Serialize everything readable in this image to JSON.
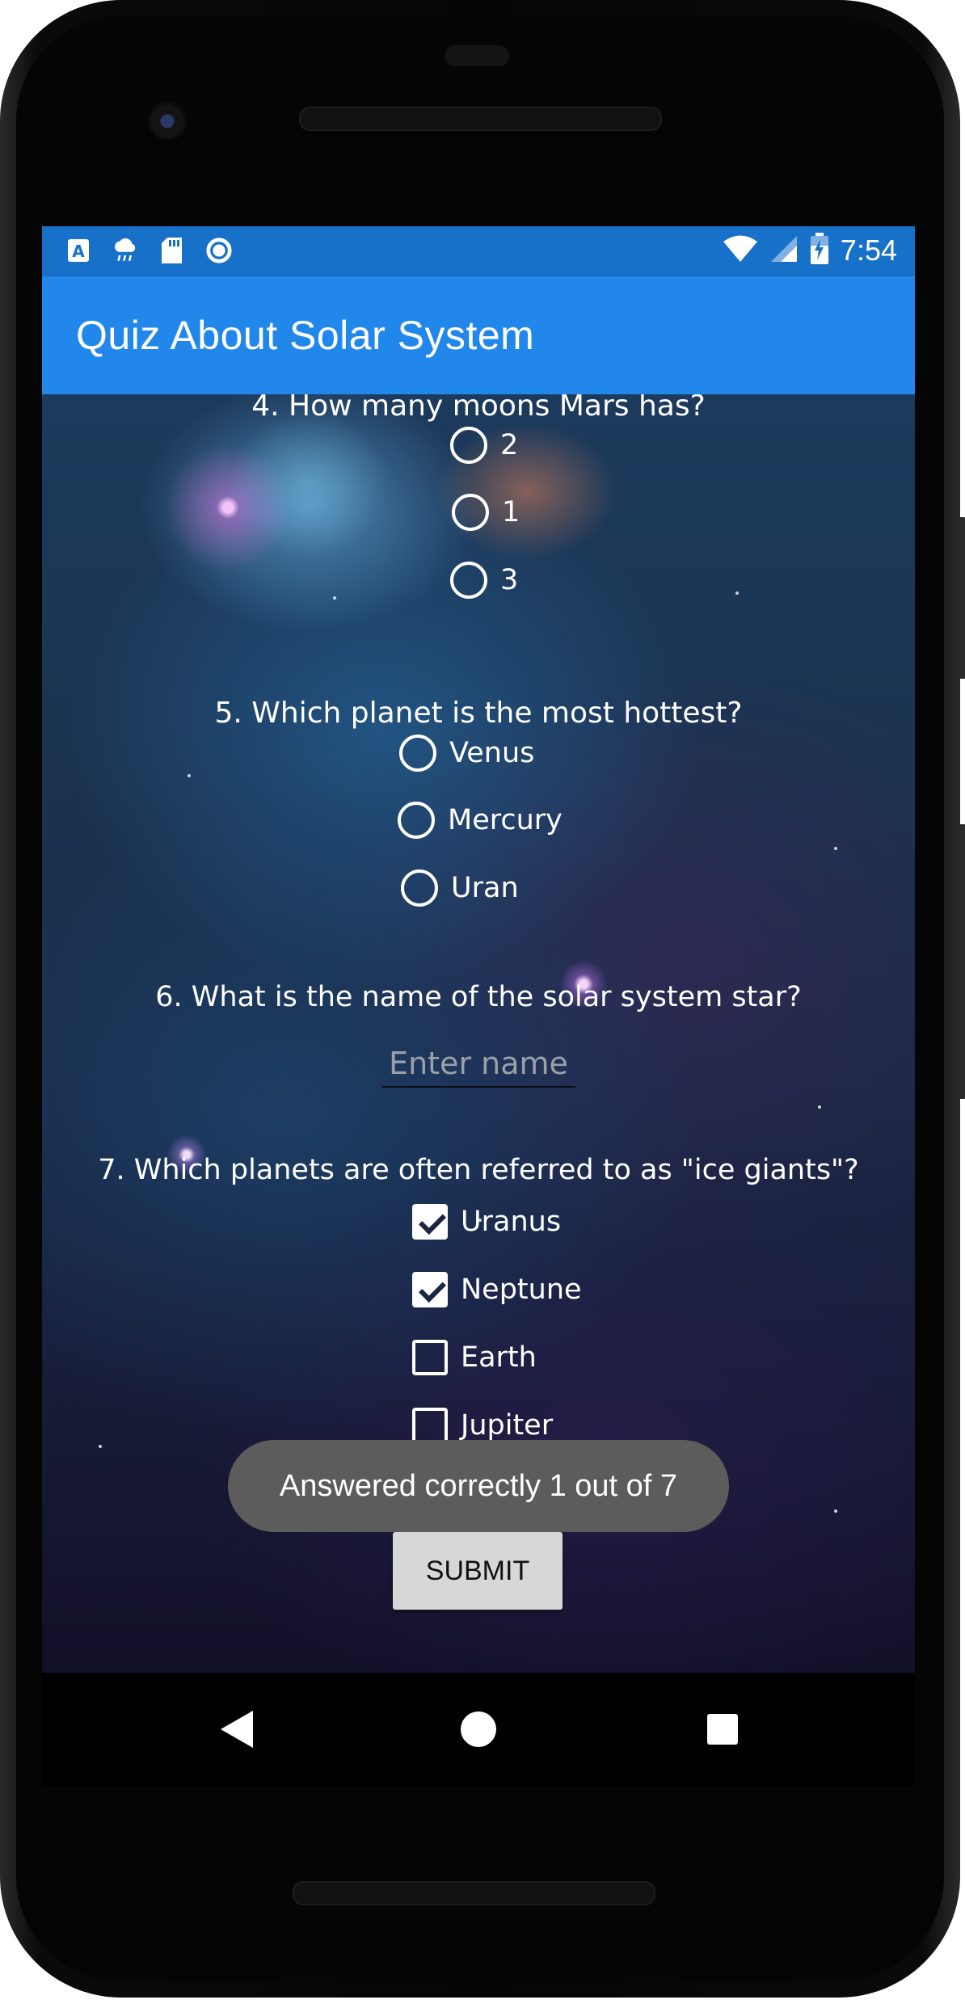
{
  "status_bar": {
    "time": "7:54",
    "left_icons": [
      "text-a-icon",
      "cloud-rain-icon",
      "sd-card-icon",
      "record-icon"
    ],
    "right_icons": [
      "wifi-icon",
      "cell-signal-icon",
      "battery-charging-icon"
    ],
    "color": "#1871c9"
  },
  "app_bar": {
    "title": "Quiz About Solar System",
    "color": "#2187ea"
  },
  "questions": [
    {
      "text": "4. How many moons Mars has?",
      "type": "radio",
      "options": [
        {
          "label": "2",
          "selected": false
        },
        {
          "label": "1",
          "selected": false
        },
        {
          "label": "3",
          "selected": false
        }
      ]
    },
    {
      "text": "5. Which planet is the most hottest?",
      "type": "radio",
      "options": [
        {
          "label": "Venus",
          "selected": false
        },
        {
          "label": "Mercury",
          "selected": false
        },
        {
          "label": "Uran",
          "selected": false
        }
      ]
    },
    {
      "text": "6. What is the name of the solar system star?",
      "type": "text",
      "value": "",
      "placeholder": "Enter name"
    },
    {
      "text": "7. Which planets are often referred to as \"ice giants\"?",
      "type": "checkbox",
      "options": [
        {
          "label": "Uranus",
          "checked": true
        },
        {
          "label": "Neptune",
          "checked": true
        },
        {
          "label": "Earth",
          "checked": false
        },
        {
          "label": "Jupiter",
          "checked": false
        }
      ]
    }
  ],
  "submit_label": "SUBMIT",
  "toast": "Answered correctly 1 out of 7",
  "nav_bar": [
    "back-icon",
    "home-icon",
    "recents-icon"
  ]
}
